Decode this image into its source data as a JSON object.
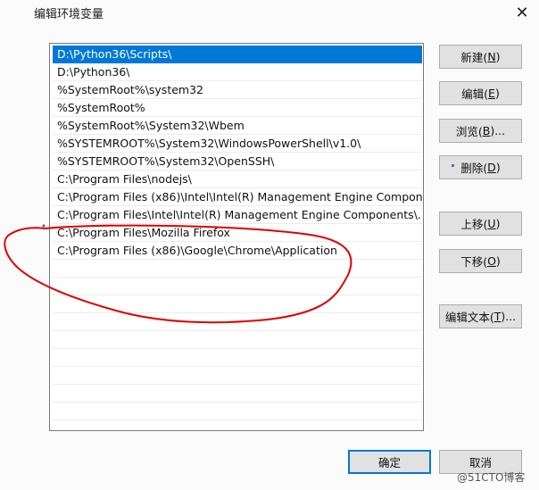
{
  "window": {
    "title": "编辑环境变量",
    "close_glyph": "✕"
  },
  "path_list": {
    "items": [
      "D:\\Python36\\Scripts\\",
      "D:\\Python36\\",
      "%SystemRoot%\\system32",
      "%SystemRoot%",
      "%SystemRoot%\\System32\\Wbem",
      "%SYSTEMROOT%\\System32\\WindowsPowerShell\\v1.0\\",
      "%SYSTEMROOT%\\System32\\OpenSSH\\",
      "C:\\Program Files\\nodejs\\",
      "C:\\Program Files (x86)\\Intel\\Intel(R) Management Engine Compon...",
      "C:\\Program Files\\Intel\\Intel(R) Management Engine Components\\...",
      "C:\\Program Files\\Mozilla Firefox",
      "C:\\Program Files (x86)\\Google\\Chrome\\Application"
    ],
    "selected_index": 0
  },
  "buttons": {
    "new": {
      "text": "新建(",
      "key": "N",
      "end": ")"
    },
    "edit": {
      "text": "编辑(",
      "key": "E",
      "end": ")"
    },
    "browse": {
      "text": "浏览(",
      "key": "B",
      "end": ")..."
    },
    "delete": {
      "text": "删除(",
      "key": "D",
      "end": ")"
    },
    "move_up": {
      "text": "上移(",
      "key": "U",
      "end": ")"
    },
    "move_down": {
      "text": "下移(",
      "key": "O",
      "end": ")"
    },
    "edit_text": {
      "text": "编辑文本(",
      "key": "T",
      "end": ")..."
    },
    "ok": "确定",
    "cancel": "取消"
  },
  "watermark": "@51CTO博客",
  "colors": {
    "selection": "#0078d7",
    "annotation": "#e00000"
  }
}
